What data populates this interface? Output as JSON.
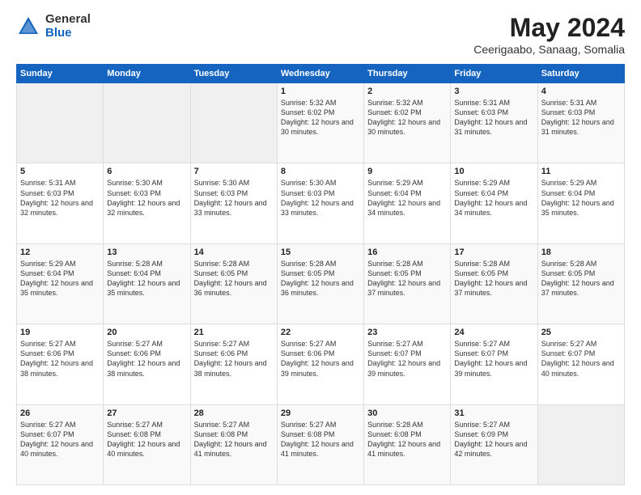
{
  "header": {
    "logo_general": "General",
    "logo_blue": "Blue",
    "month_title": "May 2024",
    "location": "Ceerigaabo, Sanaag, Somalia"
  },
  "weekdays": [
    "Sunday",
    "Monday",
    "Tuesday",
    "Wednesday",
    "Thursday",
    "Friday",
    "Saturday"
  ],
  "weeks": [
    [
      {
        "day": "",
        "sunrise": "",
        "sunset": "",
        "daylight": ""
      },
      {
        "day": "",
        "sunrise": "",
        "sunset": "",
        "daylight": ""
      },
      {
        "day": "",
        "sunrise": "",
        "sunset": "",
        "daylight": ""
      },
      {
        "day": "1",
        "sunrise": "5:32 AM",
        "sunset": "6:02 PM",
        "daylight": "12 hours and 30 minutes."
      },
      {
        "day": "2",
        "sunrise": "5:32 AM",
        "sunset": "6:02 PM",
        "daylight": "12 hours and 30 minutes."
      },
      {
        "day": "3",
        "sunrise": "5:31 AM",
        "sunset": "6:03 PM",
        "daylight": "12 hours and 31 minutes."
      },
      {
        "day": "4",
        "sunrise": "5:31 AM",
        "sunset": "6:03 PM",
        "daylight": "12 hours and 31 minutes."
      }
    ],
    [
      {
        "day": "5",
        "sunrise": "5:31 AM",
        "sunset": "6:03 PM",
        "daylight": "12 hours and 32 minutes."
      },
      {
        "day": "6",
        "sunrise": "5:30 AM",
        "sunset": "6:03 PM",
        "daylight": "12 hours and 32 minutes."
      },
      {
        "day": "7",
        "sunrise": "5:30 AM",
        "sunset": "6:03 PM",
        "daylight": "12 hours and 33 minutes."
      },
      {
        "day": "8",
        "sunrise": "5:30 AM",
        "sunset": "6:03 PM",
        "daylight": "12 hours and 33 minutes."
      },
      {
        "day": "9",
        "sunrise": "5:29 AM",
        "sunset": "6:04 PM",
        "daylight": "12 hours and 34 minutes."
      },
      {
        "day": "10",
        "sunrise": "5:29 AM",
        "sunset": "6:04 PM",
        "daylight": "12 hours and 34 minutes."
      },
      {
        "day": "11",
        "sunrise": "5:29 AM",
        "sunset": "6:04 PM",
        "daylight": "12 hours and 35 minutes."
      }
    ],
    [
      {
        "day": "12",
        "sunrise": "5:29 AM",
        "sunset": "6:04 PM",
        "daylight": "12 hours and 35 minutes."
      },
      {
        "day": "13",
        "sunrise": "5:28 AM",
        "sunset": "6:04 PM",
        "daylight": "12 hours and 35 minutes."
      },
      {
        "day": "14",
        "sunrise": "5:28 AM",
        "sunset": "6:05 PM",
        "daylight": "12 hours and 36 minutes."
      },
      {
        "day": "15",
        "sunrise": "5:28 AM",
        "sunset": "6:05 PM",
        "daylight": "12 hours and 36 minutes."
      },
      {
        "day": "16",
        "sunrise": "5:28 AM",
        "sunset": "6:05 PM",
        "daylight": "12 hours and 37 minutes."
      },
      {
        "day": "17",
        "sunrise": "5:28 AM",
        "sunset": "6:05 PM",
        "daylight": "12 hours and 37 minutes."
      },
      {
        "day": "18",
        "sunrise": "5:28 AM",
        "sunset": "6:05 PM",
        "daylight": "12 hours and 37 minutes."
      }
    ],
    [
      {
        "day": "19",
        "sunrise": "5:27 AM",
        "sunset": "6:06 PM",
        "daylight": "12 hours and 38 minutes."
      },
      {
        "day": "20",
        "sunrise": "5:27 AM",
        "sunset": "6:06 PM",
        "daylight": "12 hours and 38 minutes."
      },
      {
        "day": "21",
        "sunrise": "5:27 AM",
        "sunset": "6:06 PM",
        "daylight": "12 hours and 38 minutes."
      },
      {
        "day": "22",
        "sunrise": "5:27 AM",
        "sunset": "6:06 PM",
        "daylight": "12 hours and 39 minutes."
      },
      {
        "day": "23",
        "sunrise": "5:27 AM",
        "sunset": "6:07 PM",
        "daylight": "12 hours and 39 minutes."
      },
      {
        "day": "24",
        "sunrise": "5:27 AM",
        "sunset": "6:07 PM",
        "daylight": "12 hours and 39 minutes."
      },
      {
        "day": "25",
        "sunrise": "5:27 AM",
        "sunset": "6:07 PM",
        "daylight": "12 hours and 40 minutes."
      }
    ],
    [
      {
        "day": "26",
        "sunrise": "5:27 AM",
        "sunset": "6:07 PM",
        "daylight": "12 hours and 40 minutes."
      },
      {
        "day": "27",
        "sunrise": "5:27 AM",
        "sunset": "6:08 PM",
        "daylight": "12 hours and 40 minutes."
      },
      {
        "day": "28",
        "sunrise": "5:27 AM",
        "sunset": "6:08 PM",
        "daylight": "12 hours and 41 minutes."
      },
      {
        "day": "29",
        "sunrise": "5:27 AM",
        "sunset": "6:08 PM",
        "daylight": "12 hours and 41 minutes."
      },
      {
        "day": "30",
        "sunrise": "5:28 AM",
        "sunset": "6:08 PM",
        "daylight": "12 hours and 41 minutes."
      },
      {
        "day": "31",
        "sunrise": "5:27 AM",
        "sunset": "6:09 PM",
        "daylight": "12 hours and 42 minutes."
      },
      {
        "day": "",
        "sunrise": "",
        "sunset": "",
        "daylight": ""
      }
    ]
  ]
}
